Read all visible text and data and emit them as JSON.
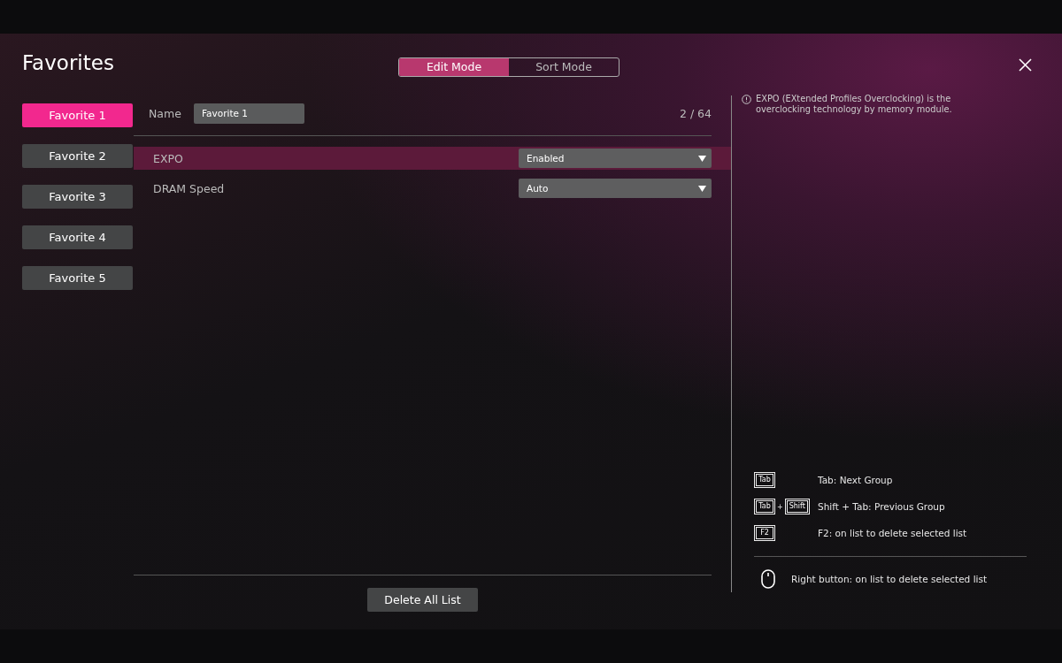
{
  "title": "Favorites",
  "modes": [
    {
      "label": "Edit Mode",
      "selected": true
    },
    {
      "label": "Sort Mode",
      "selected": false
    }
  ],
  "sidebar": {
    "items": [
      {
        "label": "Favorite 1",
        "selected": true
      },
      {
        "label": "Favorite 2",
        "selected": false
      },
      {
        "label": "Favorite 3",
        "selected": false
      },
      {
        "label": "Favorite 4",
        "selected": false
      },
      {
        "label": "Favorite 5",
        "selected": false
      }
    ]
  },
  "name_field": {
    "label": "Name",
    "value": "Favorite 1"
  },
  "count": "2 / 64",
  "settings": [
    {
      "label": "EXPO",
      "value": "Enabled",
      "selected": true
    },
    {
      "label": "DRAM Speed",
      "value": "Auto",
      "selected": false
    }
  ],
  "delete_button": "Delete All List",
  "help_text": "EXPO (EXtended Profiles Overclocking) is the overclocking technology by memory module.",
  "shortcuts": [
    {
      "kind": "keys",
      "keys": [
        "Tab"
      ],
      "text": "Tab: Next Group"
    },
    {
      "kind": "keys",
      "keys": [
        "Tab",
        "Shift"
      ],
      "joiner": "+",
      "text": "Shift + Tab: Previous Group"
    },
    {
      "kind": "keys",
      "keys": [
        "F2"
      ],
      "text": "F2: on list to delete selected list"
    },
    {
      "kind": "mouse",
      "text": "Right button: on list to delete selected list"
    }
  ]
}
